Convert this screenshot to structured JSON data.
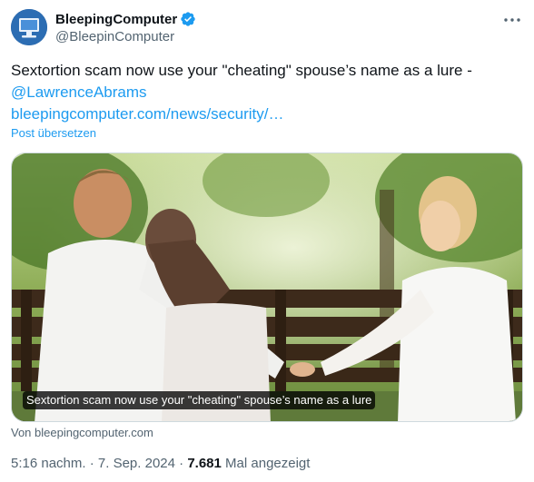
{
  "author": {
    "display_name": "BleepingComputer",
    "handle": "@BleepinComputer"
  },
  "tweet": {
    "text_line1": "Sextortion scam now use your \"cheating\" spouse’s name as a lure -",
    "mention": "@LawrenceAbrams",
    "url": "bleepingcomputer.com/news/security/…",
    "translate_label": "Post übersetzen"
  },
  "card": {
    "caption": "Sextortion scam now use your \"cheating\" spouse’s name as a lure",
    "source": "Von bleepingcomputer.com"
  },
  "meta": {
    "time": "5:16 nachm.",
    "sep1": " · ",
    "date": "7. Sep. 2024",
    "sep2": " · ",
    "views_count": "7.681",
    "views_label": " Mal angezeigt"
  },
  "icons": {
    "verified": "verified-badge-icon",
    "more": "more-horizontal-icon"
  },
  "colors": {
    "accent": "#1d9bf0",
    "secondary_text": "#536471",
    "primary_text": "#0f1419"
  }
}
